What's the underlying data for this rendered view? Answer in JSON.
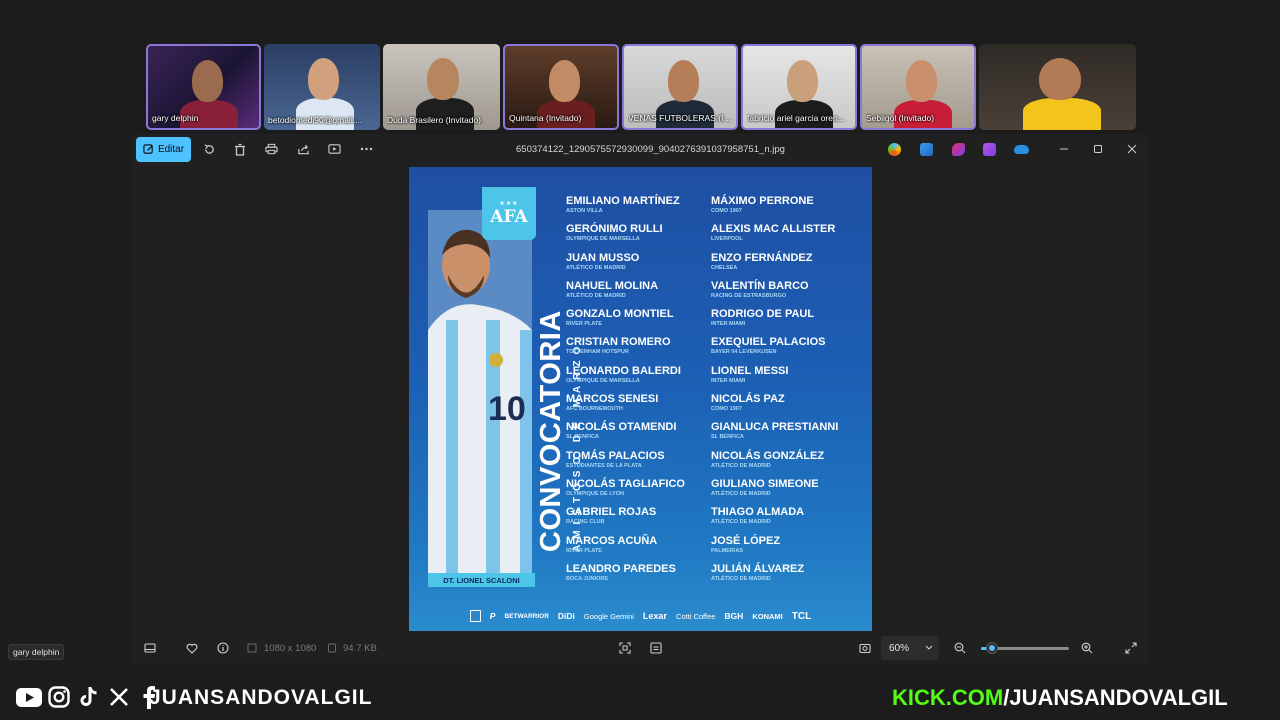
{
  "participants": [
    {
      "name": "gary delphin",
      "selected": true
    },
    {
      "name": "betodiomedi90@gmail....",
      "selected": false
    },
    {
      "name": "Duda Brasilero (Invitado)",
      "selected": false
    },
    {
      "name": "Quintana (Invitado)",
      "selected": true
    },
    {
      "name": "VENAS FUTBOLERAS (In...",
      "selected": true
    },
    {
      "name": "fabricio ariel garcia oren...",
      "selected": true
    },
    {
      "name": "Sebiigol (Invitado)",
      "selected": true
    },
    {
      "name": "",
      "selected": false
    }
  ],
  "viewer": {
    "edit_label": "Editar",
    "filename": "650374122_1290575572930099_9040276391037958751_n.jpg",
    "dimensions": "1080 x 1080",
    "filesize": "94.7 KB",
    "zoom": "60%",
    "zoom_fraction": 0.12
  },
  "poster": {
    "logo_text": "AFA",
    "title": "CONVOCATORIA",
    "subtitle": "AMISTOSO DE MARZO",
    "coach": "DT. LIONEL SCALONI",
    "players_left": [
      {
        "name": "EMILIANO MARTÍNEZ",
        "club": "ASTON VILLA"
      },
      {
        "name": "GERÓNIMO RULLI",
        "club": "OLYMPIQUE DE MARSELLA"
      },
      {
        "name": "JUAN MUSSO",
        "club": "ATLÉTICO DE MADRID"
      },
      {
        "name": "NAHUEL MOLINA",
        "club": "ATLÉTICO DE MADRID"
      },
      {
        "name": "GONZALO MONTIEL",
        "club": "RIVER PLATE"
      },
      {
        "name": "CRISTIAN ROMERO",
        "club": "TOTTENHAM HOTSPUR"
      },
      {
        "name": "LEONARDO BALERDI",
        "club": "OLYMPIQUE DE MARSELLA"
      },
      {
        "name": "MARCOS SENESI",
        "club": "AFC BOURNEMOUTH"
      },
      {
        "name": "NICOLÁS OTAMENDI",
        "club": "SL BENFICA"
      },
      {
        "name": "TOMÁS PALACIOS",
        "club": "ESTUDIANTES DE LA PLATA"
      },
      {
        "name": "NICOLÁS TAGLIAFICO",
        "club": "OLYMPIQUE DE LYON"
      },
      {
        "name": "GABRIEL ROJAS",
        "club": "RACING CLUB"
      },
      {
        "name": "MARCOS ACUÑA",
        "club": "RIVER PLATE"
      },
      {
        "name": "LEANDRO PAREDES",
        "club": "BOCA JUNIORS"
      }
    ],
    "players_right": [
      {
        "name": "MÁXIMO PERRONE",
        "club": "COMO 1907"
      },
      {
        "name": "ALEXIS MAC ALLISTER",
        "club": "LIVERPOOL"
      },
      {
        "name": "ENZO FERNÁNDEZ",
        "club": "CHELSEA"
      },
      {
        "name": "VALENTÍN BARCO",
        "club": "RACING DE ESTRASBURGO"
      },
      {
        "name": "RODRIGO DE PAUL",
        "club": "INTER MIAMI"
      },
      {
        "name": "EXEQUIEL PALACIOS",
        "club": "BAYER 04 LEVERKUSEN"
      },
      {
        "name": "LIONEL MESSI",
        "club": "INTER MIAMI"
      },
      {
        "name": "NICOLÁS PAZ",
        "club": "COMO 1907"
      },
      {
        "name": "GIANLUCA PRESTIANNI",
        "club": "SL BENFICA"
      },
      {
        "name": "NICOLÁS GONZÁLEZ",
        "club": "ATLÉTICO DE MADRID"
      },
      {
        "name": "GIULIANO SIMEONE",
        "club": "ATLÉTICO DE MADRID"
      },
      {
        "name": "THIAGO ALMADA",
        "club": "ATLÉTICO DE MADRID"
      },
      {
        "name": "JOSÉ LÓPEZ",
        "club": "PALMEIRAS"
      },
      {
        "name": "JULIÁN ÁLVAREZ",
        "club": "ATLÉTICO DE MADRID"
      }
    ],
    "sponsors": [
      "BETWARRIOR",
      "DiDi",
      "Google Gemini",
      "Lexar",
      "Cotti Coffee",
      "BGH",
      "KONAMI",
      "TCL"
    ]
  },
  "tooltip": "gary delphin",
  "overlay": {
    "handle": "JUANSANDOVALGIL",
    "kick_domain": "KICK.COM",
    "kick_path": "/JUANSANDOVALGIL",
    "kick_color": "#53fc18"
  },
  "icons": {
    "rotate": "rotate-icon",
    "delete": "trash-icon",
    "print": "print-icon",
    "share": "share-icon",
    "slideshow": "slideshow-icon",
    "more": "more-icon"
  }
}
